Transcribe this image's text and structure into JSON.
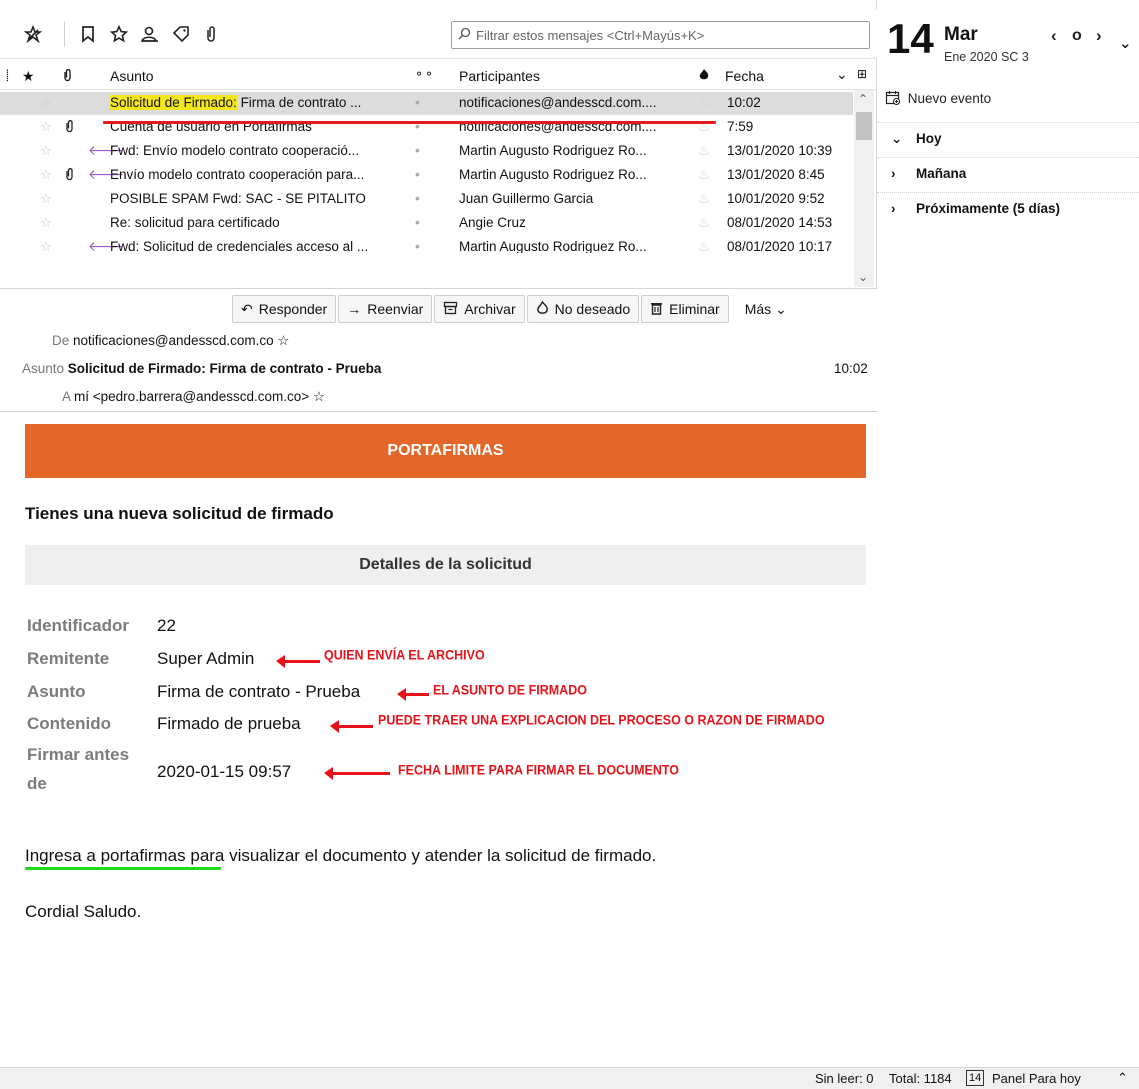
{
  "toolbar": {
    "icons": [
      "get-messages-icon",
      "bookmark-icon",
      "star-icon",
      "contacts-icon",
      "tag-icon",
      "attachment-icon"
    ],
    "filter_placeholder": "Filtrar estos mensajes <Ctrl+Mayús+K>"
  },
  "list": {
    "columns": {
      "subject": "Asunto",
      "participants": "Participantes",
      "date": "Fecha"
    },
    "rows": [
      {
        "subject_prefix": "Solicitud de Firmado:",
        "subject": " Firma de contrato ...",
        "participants": "notificaciones@andesscd.com....",
        "date": "10:02",
        "attachment": false,
        "forwarded": false,
        "selected": true
      },
      {
        "subject_prefix": "",
        "subject": "Cuenta de usuario en Portafirmas",
        "participants": "notificaciones@andesscd.com....",
        "date": "7:59",
        "attachment": true,
        "forwarded": false,
        "selected": false
      },
      {
        "subject_prefix": "",
        "subject": "Fwd: Envío modelo contrato cooperació...",
        "participants": "Martin Augusto Rodriguez Ro...",
        "date": "13/01/2020 10:39",
        "attachment": false,
        "forwarded": true,
        "selected": false
      },
      {
        "subject_prefix": "",
        "subject": "Envío modelo contrato cooperación para...",
        "participants": "Martin Augusto Rodriguez Ro...",
        "date": "13/01/2020 8:45",
        "attachment": true,
        "forwarded": true,
        "selected": false
      },
      {
        "subject_prefix": "",
        "subject": "POSIBLE SPAM Fwd: SAC - SE PITALITO",
        "participants": "Juan Guillermo Garcia",
        "date": "10/01/2020 9:52",
        "attachment": false,
        "forwarded": false,
        "selected": false
      },
      {
        "subject_prefix": "",
        "subject": "Re: solicitud para certificado",
        "participants": "Angie Cruz",
        "date": "08/01/2020 14:53",
        "attachment": false,
        "forwarded": false,
        "selected": false
      },
      {
        "subject_prefix": "",
        "subject": "Fwd: Solicitud de credenciales acceso al ...",
        "participants": "Martin Augusto Rodriguez Ro...",
        "date": "08/01/2020 10:17",
        "attachment": false,
        "forwarded": true,
        "selected": false
      }
    ]
  },
  "actions": {
    "reply": "Responder",
    "forward": "Reenviar",
    "archive": "Archivar",
    "junk": "No deseado",
    "delete": "Eliminar",
    "more": "Más"
  },
  "header": {
    "from_label": "De",
    "from": "notificaciones@andesscd.com.co",
    "subject_label": "Asunto",
    "subject": "Solicitud de Firmado: Firma de contrato - Prueba",
    "time": "10:02",
    "to_label": "A",
    "to": "mí <pedro.barrera@andesscd.com.co>"
  },
  "message": {
    "banner": "PORTAFIRMAS",
    "heading": "Tienes una nueva solicitud de firmado",
    "details_title": "Detalles de la solicitud",
    "fields": [
      {
        "label": "Identificador",
        "value": "22"
      },
      {
        "label": "Remitente",
        "value": "Super Admin"
      },
      {
        "label": "Asunto",
        "value": "Firma de contrato - Prueba"
      },
      {
        "label": "Contenido",
        "value": "Firmado de prueba"
      },
      {
        "label_line1": "Firmar antes",
        "label_line2": "de",
        "value": "2020-01-15 09:57"
      }
    ],
    "link_text": "Ingresa a portafirmas",
    "paragraph_rest": " para visualizar el documento y atender la solicitud de firmado.",
    "closing": "Cordial Saludo."
  },
  "annotations": {
    "sender": "QUIEN ENVÍA EL ARCHIVO",
    "subject": "EL ASUNTO DE FIRMADO",
    "content": "PUEDE TRAER UNA EXPLICACION DEL PROCESO O RAZON DE FIRMADO",
    "deadline": "FECHA LIMITE PARA FIRMAR EL DOCUMENTO"
  },
  "calendar": {
    "day": "14",
    "weekday": "Mar",
    "subtitle": "Ene 2020  SC 3",
    "new_event": "Nuevo evento",
    "agenda": [
      {
        "label": "Hoy",
        "expanded": true
      },
      {
        "label": "Mañana",
        "expanded": false
      },
      {
        "label": "Próximamente (5 días)",
        "expanded": false
      }
    ]
  },
  "status": {
    "unread": "Sin leer: 0",
    "total": "Total: 1184",
    "today_badge": "14",
    "today_panel": "Panel Para hoy"
  },
  "colors": {
    "banner": "#e4672a",
    "annotation": "#e8131a",
    "highlight": "#f4e61b",
    "green_underline": "#1fdc1f",
    "forward_arrow": "#a155c9"
  }
}
